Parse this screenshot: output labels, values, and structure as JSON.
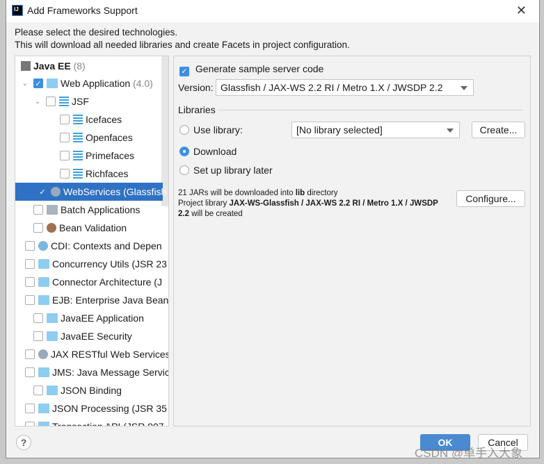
{
  "window": {
    "title": "Add Frameworks Support",
    "close_icon": "close-icon"
  },
  "description": [
    "Please select the desired technologies.",
    "This will download all needed libraries and create Facets in project configuration."
  ],
  "tree": {
    "group": {
      "label": "Java EE",
      "count": "(8)"
    },
    "items": [
      {
        "label": "Web Application",
        "suffix": "(4.0)",
        "checked": true,
        "level": 1,
        "expanded": true,
        "icon": "web-app-icon"
      },
      {
        "label": "JSF",
        "checked": false,
        "level": 2,
        "expanded": true,
        "icon": "jsf-icon"
      },
      {
        "label": "Icefaces",
        "checked": false,
        "level": 3,
        "icon": "jsf-icon"
      },
      {
        "label": "Openfaces",
        "checked": false,
        "level": 3,
        "icon": "jsf-icon"
      },
      {
        "label": "Primefaces",
        "checked": false,
        "level": 3,
        "icon": "jsf-icon"
      },
      {
        "label": "Richfaces",
        "checked": false,
        "level": 3,
        "icon": "jsf-icon"
      },
      {
        "label": "WebServices (Glassfish",
        "checked": true,
        "level": 2,
        "selected": true,
        "icon": "globe-icon"
      },
      {
        "label": "Batch Applications",
        "checked": false,
        "level": 1,
        "icon": "folder-icon"
      },
      {
        "label": "Bean Validation",
        "checked": false,
        "level": 1,
        "icon": "bean-icon"
      },
      {
        "label": "CDI: Contexts and Depen",
        "checked": false,
        "level": 1,
        "icon": "cdi-icon"
      },
      {
        "label": "Concurrency Utils (JSR 23",
        "checked": false,
        "level": 1,
        "icon": "web-app-icon"
      },
      {
        "label": "Connector Architecture (J",
        "checked": false,
        "level": 1,
        "icon": "web-app-icon"
      },
      {
        "label": "EJB: Enterprise Java Beans",
        "checked": false,
        "level": 1,
        "icon": "web-app-icon"
      },
      {
        "label": "JavaEE Application",
        "checked": false,
        "level": 1,
        "icon": "web-app-icon"
      },
      {
        "label": "JavaEE Security",
        "checked": false,
        "level": 1,
        "icon": "web-app-icon"
      },
      {
        "label": "JAX RESTful Web Services",
        "checked": false,
        "level": 1,
        "icon": "globe-icon"
      },
      {
        "label": "JMS: Java Message Servic",
        "checked": false,
        "level": 1,
        "icon": "web-app-icon"
      },
      {
        "label": "JSON Binding",
        "checked": false,
        "level": 1,
        "icon": "web-app-icon"
      },
      {
        "label": "JSON Processing (JSR 35",
        "checked": false,
        "level": 1,
        "icon": "web-app-icon"
      },
      {
        "label": "Transaction API (JSR 907",
        "checked": false,
        "level": 1,
        "icon": "web-app-icon"
      }
    ]
  },
  "settings": {
    "generate_label": "Generate sample server code",
    "generate_checked": true,
    "version_label": "Version:",
    "version_value": "Glassfish / JAX-WS 2.2 RI / Metro 1.X / JWSDP 2.2",
    "libraries_label": "Libraries",
    "use_library_label": "Use library:",
    "library_value": "[No library selected]",
    "create_label": "Create...",
    "download_label": "Download",
    "later_label": "Set up library later",
    "selected_option": "Download",
    "info_line1_a": "21 JARs will be downloaded into ",
    "info_line1_b": "lib",
    "info_line1_c": " directory",
    "info_line2_a": "Project library ",
    "info_line2_b": "JAX-WS-Glassfish / JAX-WS 2.2 RI / Metro 1.X / JWSDP",
    "info_line3_b": "2.2",
    "info_line3_c": " will be created",
    "configure_label": "Configure..."
  },
  "footer": {
    "help_label": "?",
    "ok_label": "OK",
    "cancel_label": "Cancel"
  },
  "watermark": "CSDN @单手入大象",
  "colors": {
    "accent": "#3d8fe0",
    "selection": "#2f72c4",
    "ok_button": "#4a8ad0"
  }
}
